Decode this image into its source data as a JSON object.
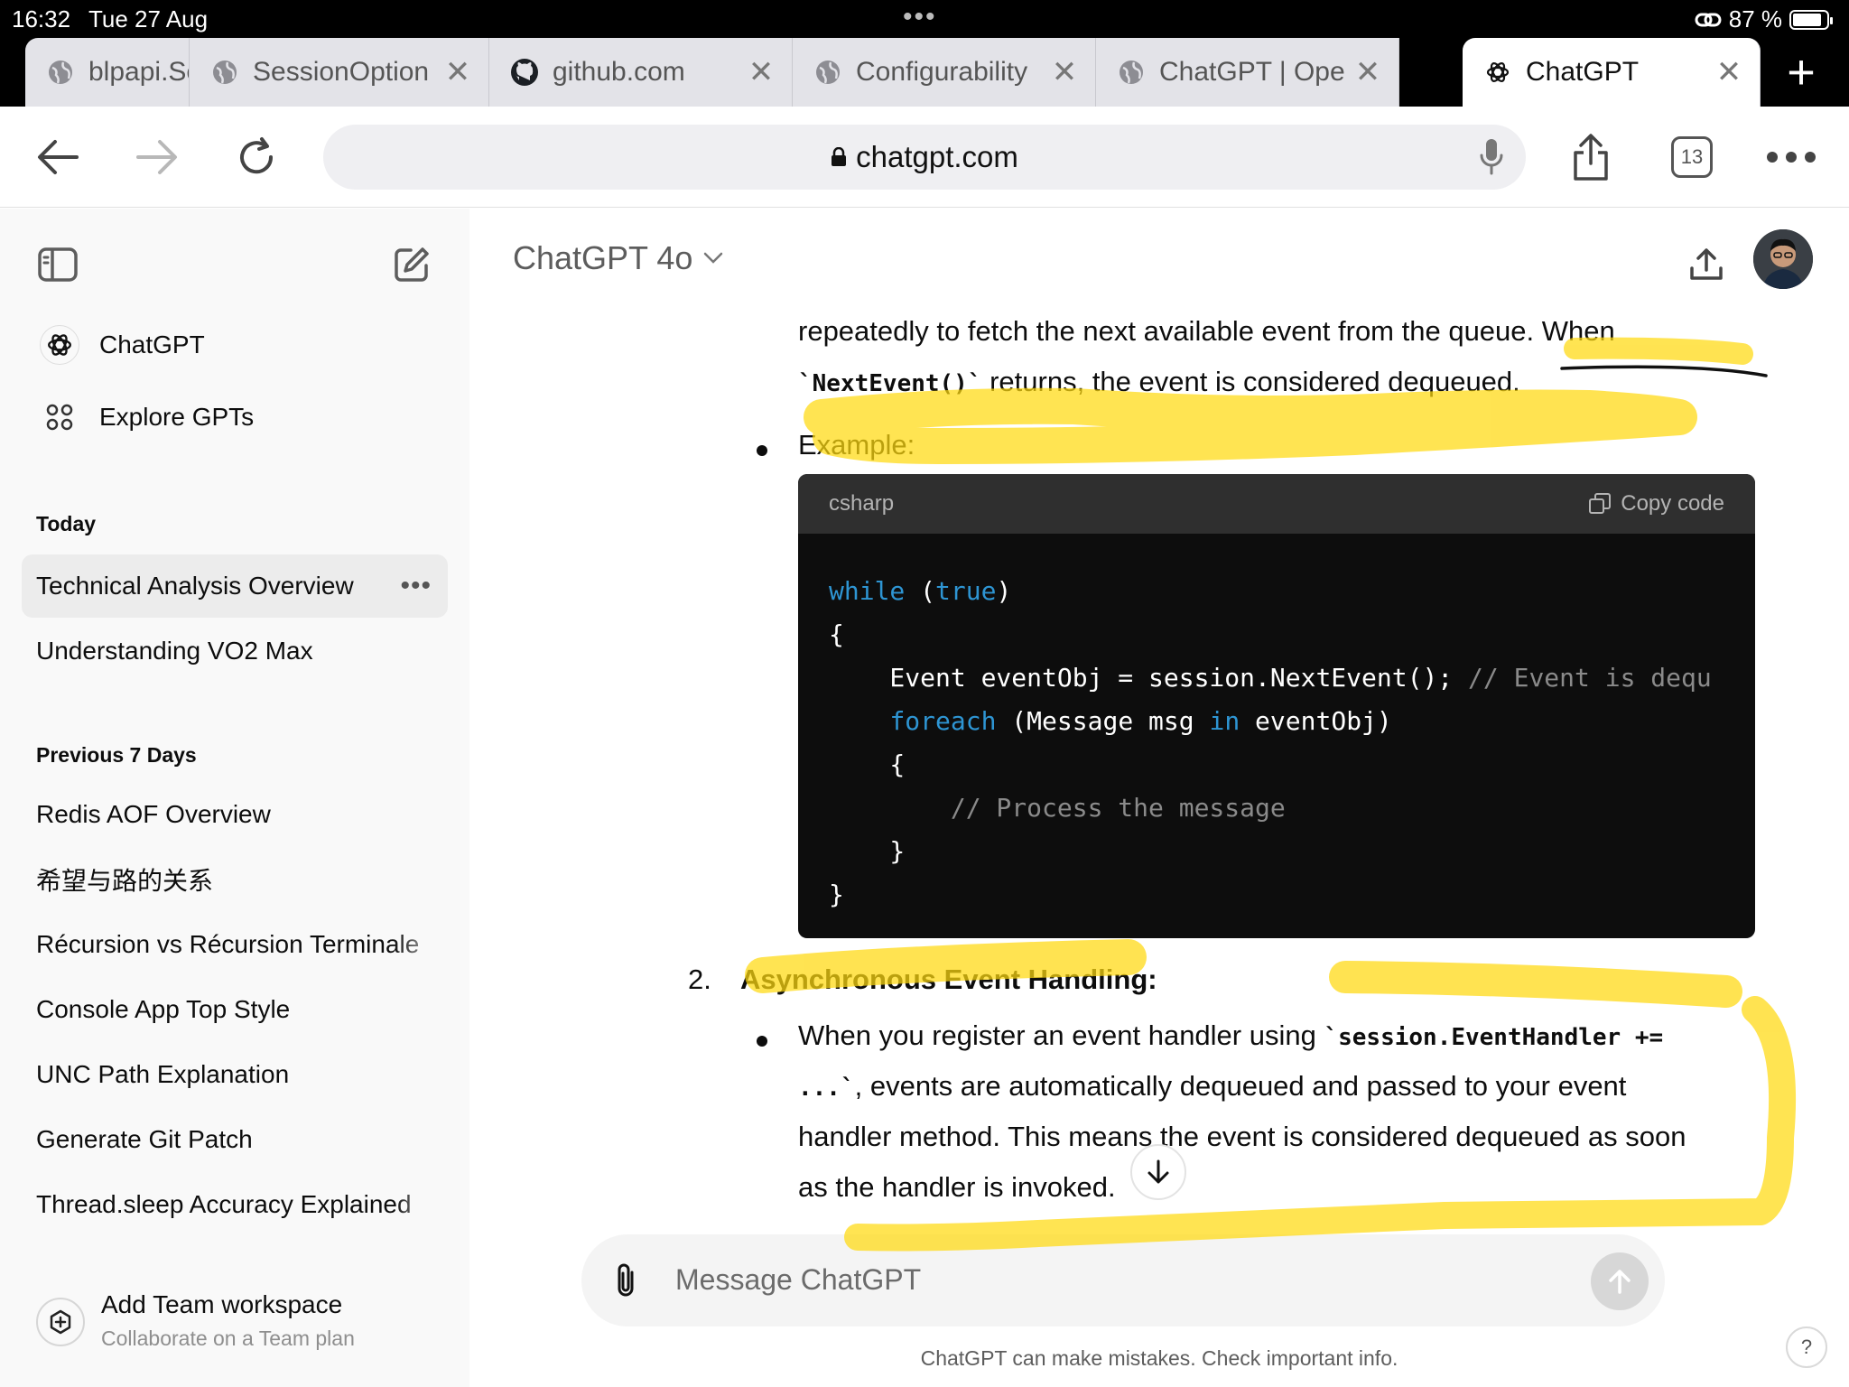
{
  "status_bar": {
    "time": "16:32",
    "date": "Tue 27 Aug",
    "battery": "87 %",
    "battery_level": 0.87
  },
  "tabs": [
    {
      "title": "blpapi.Ses",
      "icon": "globe-icon"
    },
    {
      "title": "SessionOption",
      "icon": "globe-icon"
    },
    {
      "title": "github.com",
      "icon": "github-icon"
    },
    {
      "title": "Configurability",
      "icon": "globe-icon"
    },
    {
      "title": "ChatGPT | Ope",
      "icon": "globe-icon"
    },
    {
      "title": "ChatGPT",
      "icon": "openai-icon",
      "active": true
    }
  ],
  "toolbar": {
    "url": "chatgpt.com",
    "tab_count": "13"
  },
  "sidebar": {
    "main_items": [
      {
        "label": "ChatGPT",
        "icon": "openai-icon"
      },
      {
        "label": "Explore GPTs",
        "icon": "grid-icon"
      }
    ],
    "today_heading": "Today",
    "today": [
      "Technical Analysis Overview",
      "Understanding VO2 Max"
    ],
    "more_label": "•••",
    "previous_heading": "Previous 7 Days",
    "previous": [
      "Redis AOF Overview",
      "希望与路的关系",
      "Récursion vs Récursion Terminale",
      "Console App Top Style",
      "UNC Path Explanation",
      "Generate Git Patch",
      "Thread.sleep Accuracy Explained"
    ],
    "team": {
      "title": "Add Team workspace",
      "subtitle": "Collaborate on a Team plan"
    }
  },
  "main": {
    "model": "ChatGPT 4o",
    "line1": "repeatedly to fetch the next available event from the queue. When",
    "line2_code": "`NextEvent()`",
    "line2_rest": " returns, the event is considered dequeued.",
    "example_label": "Example:",
    "code": {
      "language": "csharp",
      "copy_label": "Copy code",
      "l1_kw": "while",
      "l1_sp": " (",
      "l1_kw2": "true",
      "l1_end": ")",
      "l2": "{",
      "l3": "    Event eventObj = session.NextEvent(); ",
      "l3_comment": "// Event is dequ",
      "l4_pre": "    ",
      "l4_kw": "foreach",
      "l4_mid": " (Message msg ",
      "l4_kw2": "in",
      "l4_end": " eventObj)",
      "l5": "    {",
      "l6_pre": "        ",
      "l6_comment": "// Process the message",
      "l7": "    }",
      "l8": "}"
    },
    "item2_number": "2.",
    "item2_title": "Asynchronous Event Handling",
    "item2_colon": ":",
    "b2_l1_text": "When you register an event handler using ",
    "b2_l1_code": "`session.EventHandler +=",
    "b2_l2_code": "...`",
    "b2_l2_text": ", events are automatically dequeued and passed to your event",
    "b2_l3": "handler method. This means the event is considered dequeued as soon",
    "b2_l4": "as the handler is invoked.",
    "composer_placeholder": "Message ChatGPT",
    "disclaimer": "ChatGPT can make mistakes. Check important info.",
    "help": "?"
  },
  "colors": {
    "highlight": "#ffe45c",
    "code_bg": "#0d0d0d",
    "code_keyword": "#2e95d3",
    "sidebar_bg": "#f9f9f9"
  }
}
